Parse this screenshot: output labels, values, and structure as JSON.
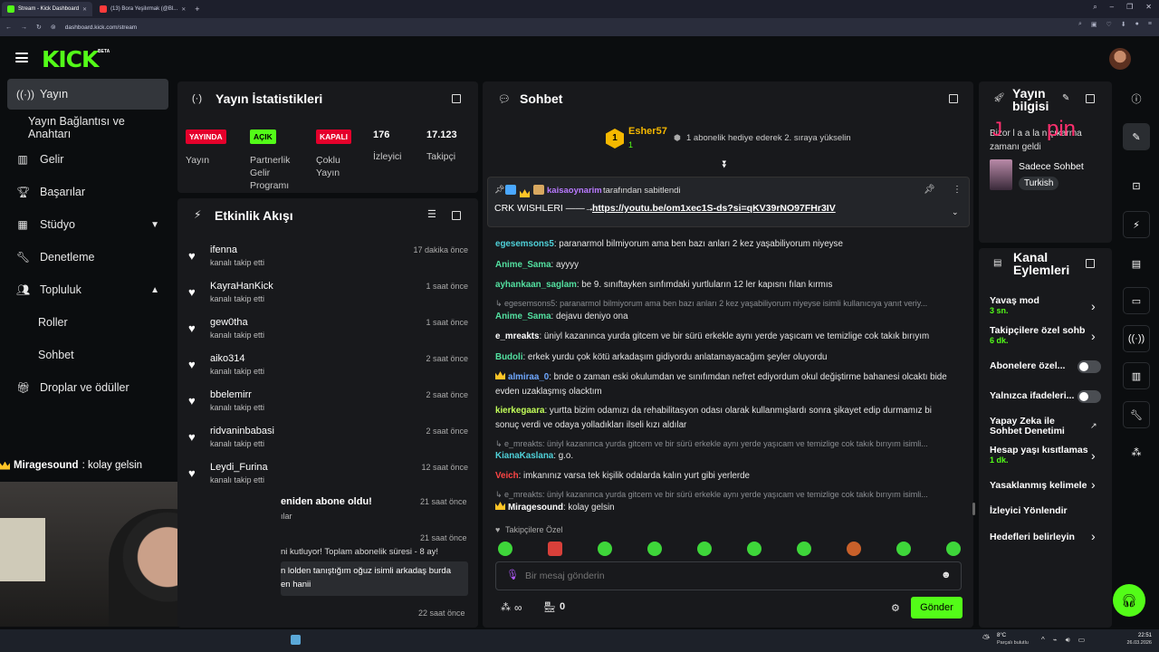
{
  "browser": {
    "tabs": [
      {
        "label": "Stream - Kick Dashboard"
      },
      {
        "label": "(13) Bora Yeşilırmak (@Bl..."
      }
    ],
    "new_tab": "+",
    "url": "dashboard.kick.com/stream"
  },
  "header": {
    "logo": "KICK",
    "beta": "BETA"
  },
  "sidebar": {
    "items": [
      {
        "label": "Yayın",
        "icon": "broadcast-icon"
      },
      {
        "label": "Yayın Bağlantısı ve Anahtarı"
      },
      {
        "label": "Gelir",
        "icon": "chart-icon"
      },
      {
        "label": "Başarılar",
        "icon": "trophy-icon"
      },
      {
        "label": "Stüdyo",
        "icon": "studio-icon"
      },
      {
        "label": "Denetleme",
        "icon": "wrench-icon"
      },
      {
        "label": "Topluluk",
        "icon": "people-icon"
      },
      {
        "label": "Roller"
      },
      {
        "label": "Sohbet"
      },
      {
        "label": "Droplar ve ödüller",
        "icon": "gift-icon"
      }
    ]
  },
  "webcam_overlay": {
    "user": "Miragesound",
    "message": ": kolay gelsin"
  },
  "stats": {
    "title": "Yayın İstatistikleri",
    "badges": [
      {
        "value": "YAYINDA",
        "label": "Yayın"
      },
      {
        "value": "AÇIK",
        "label": "Partnerlik Gelir Programı"
      },
      {
        "value": "KAPALI",
        "label": "Çoklu Yayın"
      }
    ],
    "viewers": {
      "value": "176",
      "label": "İzleyici"
    },
    "followers": {
      "value": "17.123",
      "label": "Takipçi"
    },
    "colors": {
      "live": "#e5002b",
      "on": "#53fc18"
    }
  },
  "activity": {
    "title": "Etkinlik Akışı",
    "items": [
      {
        "name": "ifenna",
        "action": "kanalı takip etti",
        "time": "17 dakika önce"
      },
      {
        "name": "KayraHanKick",
        "action": "kanalı takip etti",
        "time": "1 saat önce"
      },
      {
        "name": "gew0tha",
        "action": "kanalı takip etti",
        "time": "1 saat önce"
      },
      {
        "name": "aiko314",
        "action": "kanalı takip etti",
        "time": "2 saat önce"
      },
      {
        "name": "bbelemirr",
        "action": "kanalı takip etti",
        "time": "2 saat önce"
      },
      {
        "name": "ridvaninbabasi",
        "action": "kanalı takip etti",
        "time": "2 saat önce"
      },
      {
        "name": "Leydi_Furina",
        "action": "kanalı takip etti",
        "time": "12 saat önce"
      }
    ],
    "partial": [
      {
        "text": "eniden abone oldu!",
        "sub": "ılar",
        "time": "21 saat önce"
      },
      {
        "text": "ni kutluyor! Toplam abonelik süresi - 8 ay!",
        "time": "21 saat önce"
      },
      {
        "text": "n lolden tanıştığım oğuz isimli arkadaş burda",
        "text2": "en hanii"
      },
      {
        "time": "22 saat önce"
      }
    ]
  },
  "chat": {
    "title": "Sohbet",
    "top_gifter": {
      "rank": "1",
      "name": "Esher57",
      "count": "1",
      "note": "1 abonelik hediye ederek 2. sıraya yükselin"
    },
    "pinned": {
      "by": "kaisaoynarim",
      "by_suffix": "tarafından sabitlendi",
      "text": "CRK WISHLERI ——→",
      "link": "https://youtu.be/om1xec1S-ds?si=qKV39rNO97FHr3IV"
    },
    "messages": [
      {
        "user": "egesemsons5",
        "color": "#4fd1d9",
        "text": ": paranarmol bilmiyorum ama ben bazı anları 2 kez yaşabiliyorum niyeyse"
      },
      {
        "user": "Anime_Sama",
        "color": "#53e0a0",
        "text": ": ayyyy"
      },
      {
        "user": "ayhankaan_saglam",
        "color": "#53e0a0",
        "text": ": be 9. sınıftayken sınfımdaki yurtluların 12 ler kapısnı fılan kırmıs"
      },
      {
        "reply": "↳ egesemsons5: paranarmol bilmiyorum ama ben bazı anları 2 kez yaşabiliyorum niyeyse isimli kullanıcıya yanıt veriy..."
      },
      {
        "user": "Anime_Sama",
        "color": "#53e0a0",
        "text": ": dejavu deniyo ona"
      },
      {
        "user": "e_mreakts",
        "color": "#ffffff",
        "text": ": üniyl kazanınca yurda gitcem ve bir sürü erkekle aynı yerde yaşıcam ve temizlige cok takık bırıyım"
      },
      {
        "user": "Budoli",
        "color": "#53e0a0",
        "text": ": erkek yurdu çok kötü arkadaşım gidiyordu anlatamayacağım şeyler oluyordu"
      },
      {
        "user": "almiraa_0",
        "color": "#6fa8ff",
        "text": ": bnde o zaman eski okulumdan ve sınıfımdan nefret ediyordum okul değiştirme bahanesi olcaktı bide evden uzaklaşmış olacktım"
      },
      {
        "user": "kierkegaara",
        "color": "#c3ff5a",
        "text": ": yurtta bizim odamızı da rehabilitasyon odası olarak kullanmışlardı sonra şikayet edip durmamız bi sonuç verdi ve odaya yolladıkları ilseli kızı aldılar"
      },
      {
        "reply": "↳ e_mreakts: üniyl kazanınca yurda gitcem ve bir sürü erkekle aynı yerde yaşıcam ve temizlige cok takık bırıyım isimli..."
      },
      {
        "user": "KianaKaslana",
        "color": "#4fd1d9",
        "text": ": g.o."
      },
      {
        "user": "Veich",
        "color": "#ff4545",
        "text": ": imkanınız varsa tek kişilik odalarda kalın yurt gibi yerlerde"
      },
      {
        "reply": "↳ e_mreakts: üniyl kazanınca yurda gitcem ve bir sürü erkekle aynı yerde yaşıcam ve temizlige cok takık bırıyım isimli..."
      },
      {
        "user": "Miragesound",
        "color": "#ffffff",
        "text": ": kolay gelsin"
      }
    ],
    "emote_header": "Takipçilere Özel",
    "input_placeholder": "Bir mesaj gönderin",
    "points": "∞",
    "store_count": "0",
    "send_label": "Gönder"
  },
  "stream_info": {
    "title": "Yayın bilgisi",
    "overlay_text": "Bizor l a a la n çıkarma zamanı geldi",
    "category": "Sadece Sohbet",
    "tag": "Turkish"
  },
  "channel_actions": {
    "title": "Kanal Eylemleri",
    "items": [
      {
        "label": "Yavaş mod",
        "sub": "3 sn."
      },
      {
        "label": "Takipçilere özel sohb",
        "sub": "6 dk."
      },
      {
        "label": "Abonelere özel..."
      },
      {
        "label": "Yalnızca ifadeleri..."
      },
      {
        "label": "Yapay Zeka ile Sohbet Denetimi"
      },
      {
        "label": "Hesap yaşı kısıtlamas",
        "sub": "1 dk."
      },
      {
        "label": "Yasaklanmış kelimele"
      },
      {
        "label": "İzleyici Yönlendir"
      },
      {
        "label": "Hedefleri belirleyin"
      }
    ]
  },
  "taskbar": {
    "weather": "8°C",
    "weather_sub": "Parçalı bulutlu",
    "time": "22:51",
    "date": "26.03.2026"
  }
}
